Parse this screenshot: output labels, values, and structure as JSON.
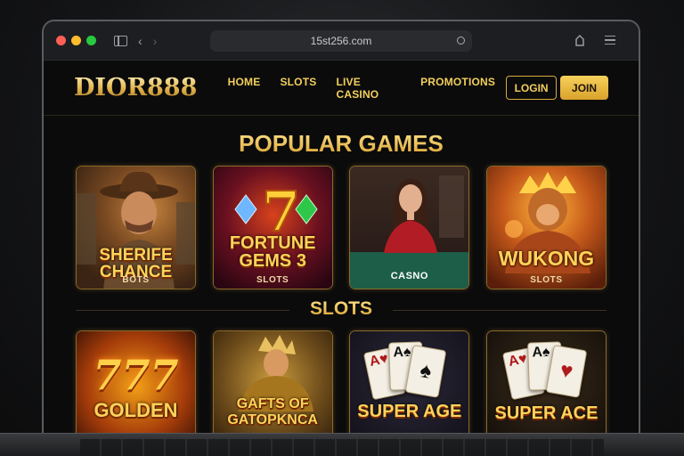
{
  "browser": {
    "url": "15st256.com"
  },
  "site": {
    "logo": "DIOR888",
    "nav": [
      "HOME",
      "SLOTS",
      "LIVE CASINO",
      "PROMOTIONS"
    ],
    "login_label": "LOGIN",
    "join_label": "JOIN"
  },
  "popular": {
    "title": "POPULAR GAMES",
    "cards": [
      {
        "name_line1": "SHERIFE",
        "name_line2": "CHANCE",
        "tag": "BOTS"
      },
      {
        "name_line1": "FORTUNE",
        "name_line2": "GEMS 3",
        "tag": "SLOTS"
      },
      {
        "name_line1": "",
        "name_line2": "",
        "tag": "CASNO"
      },
      {
        "name_line1": "WUKONG",
        "name_line2": "",
        "tag": "SLOTS"
      }
    ]
  },
  "slots": {
    "title": "SLOTS",
    "cards": [
      {
        "name_line1": "GOLDEN",
        "name_line2": "",
        "art_text": "777"
      },
      {
        "name_line1": "GAFTS OF",
        "name_line2": "GATOPKNCA"
      },
      {
        "name_line1": "SUPER AGE",
        "name_line2": ""
      },
      {
        "name_line1": "SUPER ACE",
        "name_line2": ""
      }
    ]
  },
  "icons": {
    "back": "chevron-left-icon",
    "forward": "chevron-right-icon",
    "sidebar": "sidebar-icon",
    "share": "share-icon",
    "tabs": "tabs-icon"
  },
  "colors": {
    "gold": "#f2cf5b",
    "join_bg": "#e3b33c",
    "page_bg": "#0b0b0c"
  }
}
